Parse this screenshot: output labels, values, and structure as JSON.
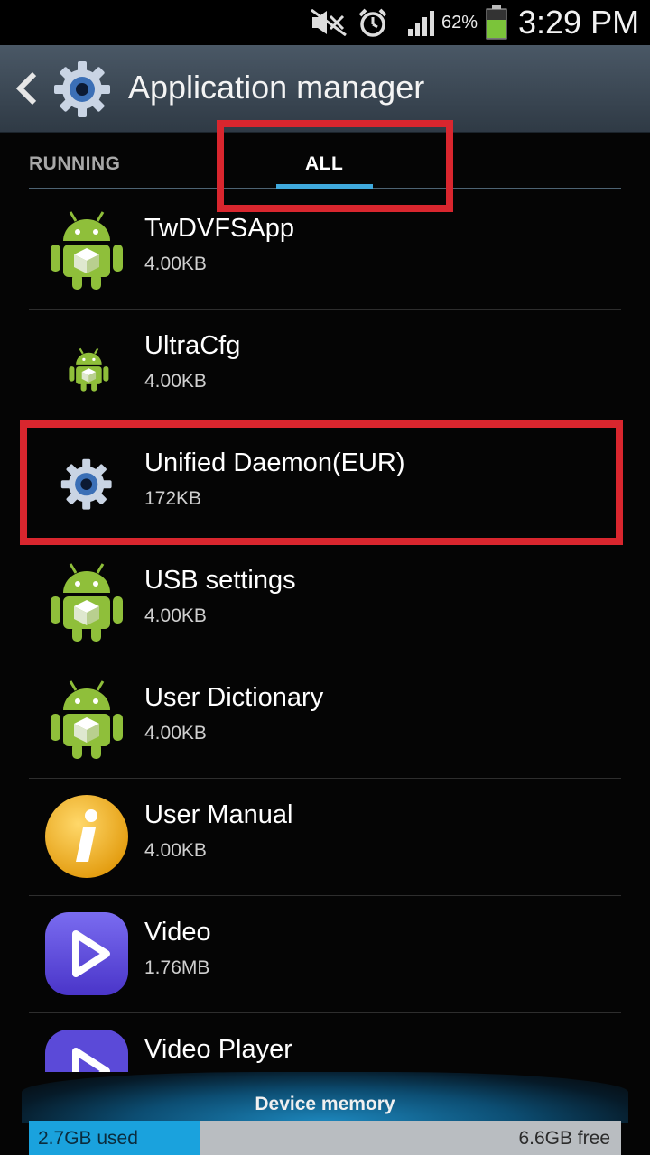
{
  "status_bar": {
    "battery_percent": "62%",
    "time": "3:29 PM",
    "icons": [
      "mute-icon",
      "alarm-icon",
      "signal-icon",
      "battery-icon"
    ]
  },
  "action_bar": {
    "title": "Application manager",
    "icons": [
      "back-arrow-icon",
      "gear-icon"
    ]
  },
  "tabs": [
    {
      "label": "RUNNING",
      "selected": false
    },
    {
      "label": "ALL",
      "selected": true
    }
  ],
  "apps": [
    {
      "name": "TwDVFSApp",
      "size": "4.00KB",
      "icon": "android-icon"
    },
    {
      "name": "UltraCfg",
      "size": "4.00KB",
      "icon": "android-small-icon"
    },
    {
      "name": "Unified Daemon(EUR)",
      "size": "172KB",
      "icon": "gear-icon"
    },
    {
      "name": "USB settings",
      "size": "4.00KB",
      "icon": "android-icon"
    },
    {
      "name": "User Dictionary",
      "size": "4.00KB",
      "icon": "android-icon"
    },
    {
      "name": "User Manual",
      "size": "4.00KB",
      "icon": "info-icon"
    },
    {
      "name": "Video",
      "size": "1.76MB",
      "icon": "play-icon"
    },
    {
      "name": "Video Player",
      "size": "",
      "icon": "play-icon"
    }
  ],
  "memory": {
    "title": "Device memory",
    "used": "2.7GB used",
    "free": "6.6GB free",
    "used_fraction": 0.29
  },
  "colors": {
    "highlight": "#d9262e",
    "tab_accent": "#3fa9dc",
    "android_green": "#8fbf3a",
    "memory_used": "#1aa2dd"
  }
}
